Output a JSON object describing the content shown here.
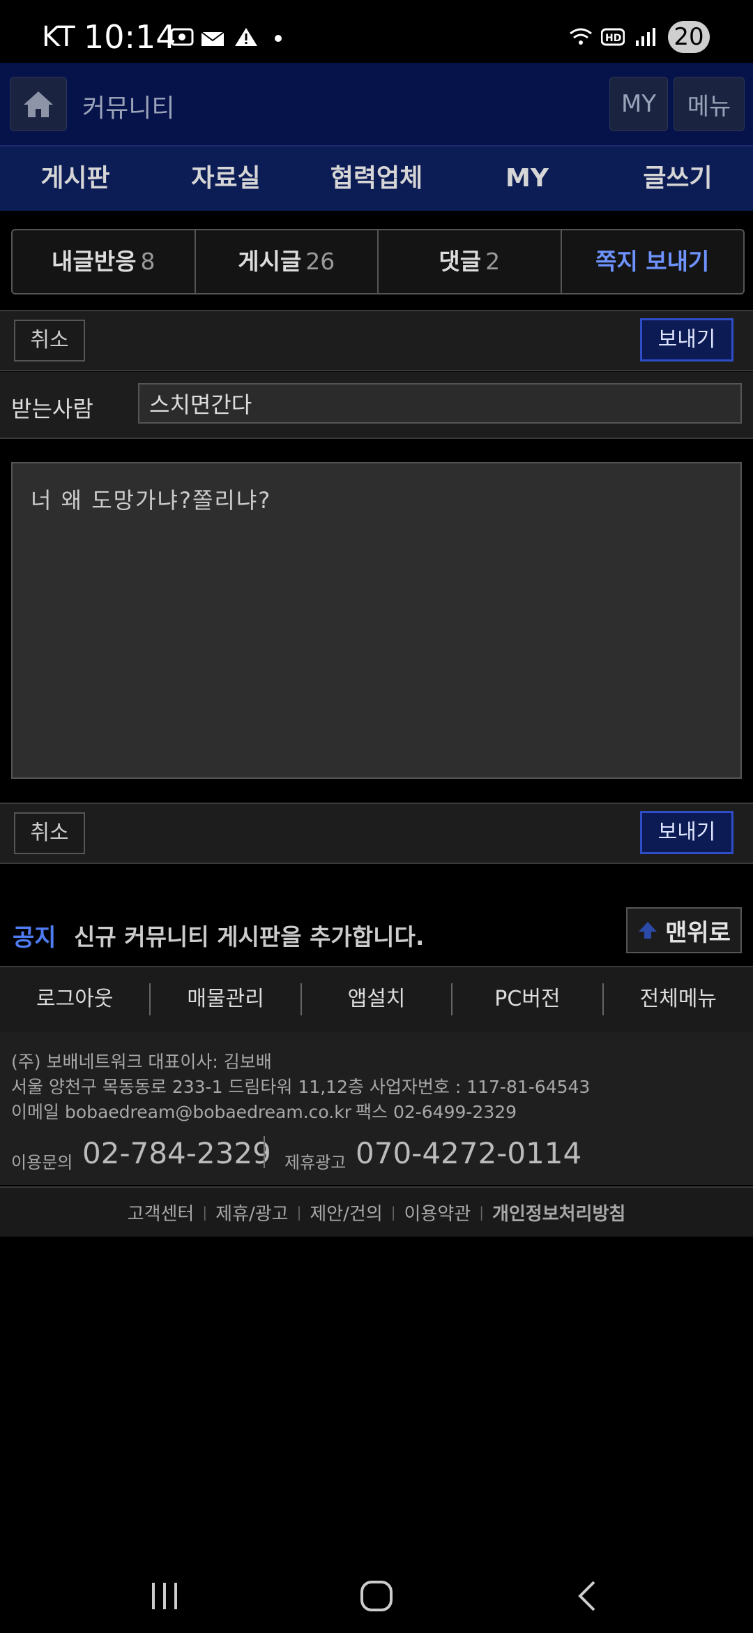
{
  "status_bar": {
    "carrier": "KT",
    "time": "10:14",
    "battery": "20"
  },
  "header": {
    "title": "커뮤니티",
    "my_label": "MY",
    "menu_label": "메뉴"
  },
  "main_nav": [
    "게시판",
    "자료실",
    "협력업체",
    "MY",
    "글쓰기"
  ],
  "tabs": [
    {
      "label": "내글반응",
      "count": "8"
    },
    {
      "label": "게시글",
      "count": "26"
    },
    {
      "label": "댓글",
      "count": "2"
    },
    {
      "label": "쪽지 보내기",
      "count": ""
    }
  ],
  "compose": {
    "cancel_label": "취소",
    "send_label": "보내기",
    "recipient_label": "받는사람",
    "recipient_value": "스치면간다",
    "message": "너 왜 도망가냐?쫄리냐?"
  },
  "notice": {
    "label": "공지",
    "text": "신규 커뮤니티 게시판을 추가합니다.",
    "top_button": "맨위로"
  },
  "footer_nav": [
    "로그아웃",
    "매물관리",
    "앱설치",
    "PC버전",
    "전체메뉴"
  ],
  "company": {
    "line1": "(주) 보배네트워크 대표이사: 김보배",
    "line2": "서울 양천구 목동동로 233-1 드림타워 11,12층 사업자번호 : 117-81-64543",
    "email": "이메일 bobaedream@bobaedream.co.kr",
    "fax": "팩스 02-6499-2329",
    "inquiry_label": "이용문의",
    "inquiry_number": "02-784-2329",
    "ad_label": "제휴광고",
    "ad_number": "070-4272-0114"
  },
  "footer_links": [
    "고객센터",
    "제휴/광고",
    "제안/건의",
    "이용약관",
    "개인정보처리방침"
  ]
}
